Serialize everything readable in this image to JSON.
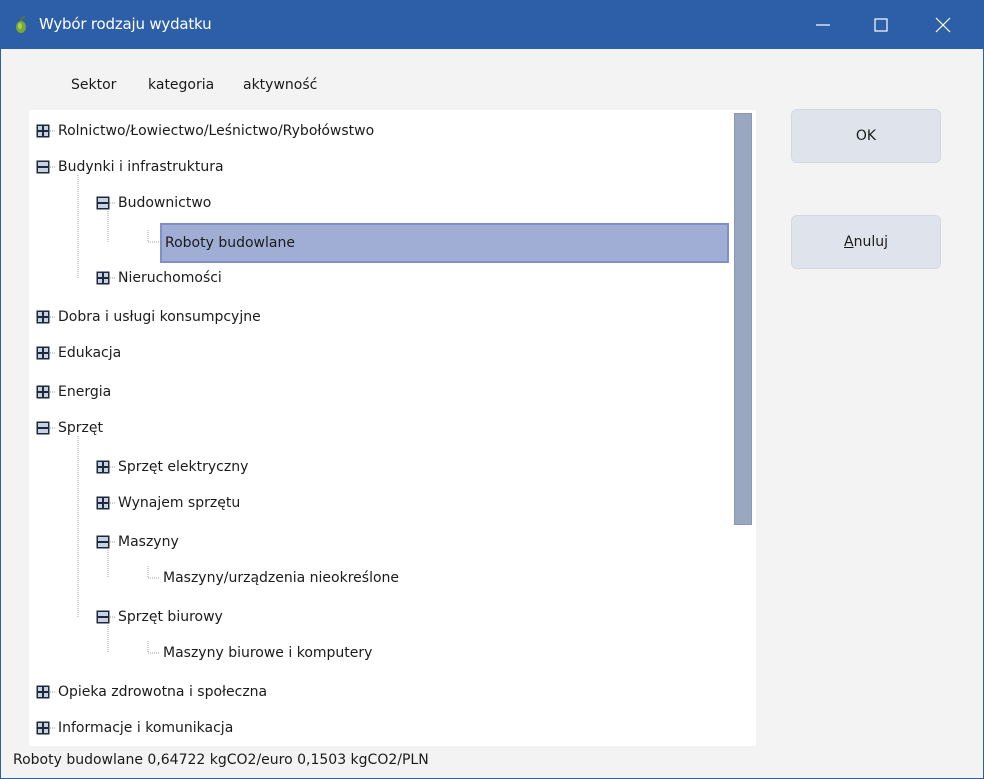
{
  "window": {
    "title": "Wybór rodzaju wydatku",
    "controls": [
      "minimize-icon",
      "maximize-icon",
      "close-icon"
    ],
    "app_icon": "leaf-icon",
    "accent_color": "#2c5fa8"
  },
  "columns": {
    "sector": "Sektor",
    "category": "kategoria",
    "activity": "aktywność"
  },
  "tree": {
    "expanded_icon": "minus-box-icon",
    "collapsed_icon": "plus-box-icon",
    "selection_color": "#a0aed5",
    "items": [
      {
        "label": "Rolnictwo/Łowiectwo/Leśnictwo/Rybołówstwo",
        "level": 0,
        "state": "collapsed"
      },
      {
        "label": "Budynki i infrastruktura",
        "level": 0,
        "state": "expanded"
      },
      {
        "label": "Budownictwo",
        "level": 1,
        "state": "expanded"
      },
      {
        "label": "Roboty budowlane",
        "level": 2,
        "state": "leaf",
        "selected": true
      },
      {
        "label": "Nieruchomości",
        "level": 1,
        "state": "collapsed"
      },
      {
        "label": "Dobra i usługi konsumpcyjne",
        "level": 0,
        "state": "collapsed"
      },
      {
        "label": "Edukacja",
        "level": 0,
        "state": "collapsed"
      },
      {
        "label": "Energia",
        "level": 0,
        "state": "collapsed"
      },
      {
        "label": "Sprzęt",
        "level": 0,
        "state": "expanded"
      },
      {
        "label": "Sprzęt elektryczny",
        "level": 1,
        "state": "collapsed"
      },
      {
        "label": "Wynajem sprzętu",
        "level": 1,
        "state": "collapsed"
      },
      {
        "label": "Maszyny",
        "level": 1,
        "state": "expanded"
      },
      {
        "label": "Maszyny/urządzenia nieokreślone",
        "level": 2,
        "state": "leaf"
      },
      {
        "label": "Sprzęt biurowy",
        "level": 1,
        "state": "expanded"
      },
      {
        "label": "Maszyny biurowe i komputery",
        "level": 2,
        "state": "leaf"
      },
      {
        "label": "Opieka zdrowotna i społeczna",
        "level": 0,
        "state": "collapsed"
      },
      {
        "label": "Informacje i komunikacja",
        "level": 0,
        "state": "collapsed"
      }
    ]
  },
  "buttons": {
    "ok": "OK",
    "cancel_accel": "A",
    "cancel_rest": "nuluj"
  },
  "status": {
    "text": "Roboty budowlane  0,64722 kgCO2/euro  0,1503 kgCO2/PLN"
  }
}
